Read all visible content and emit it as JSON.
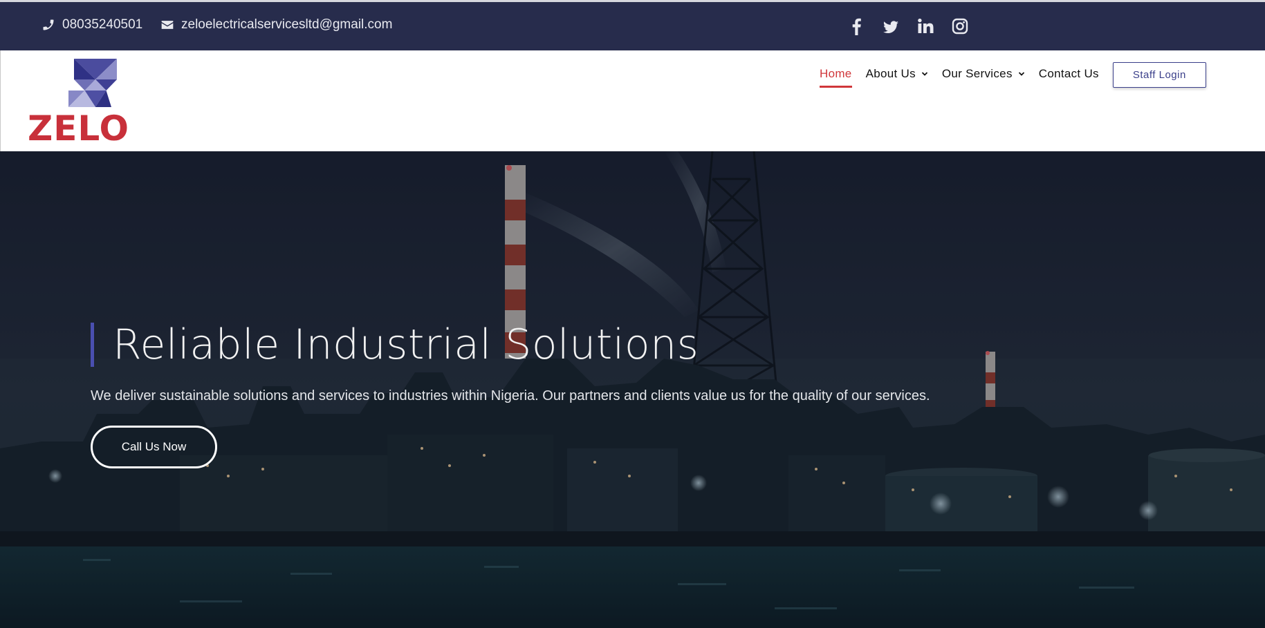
{
  "topbar": {
    "phone": "08035240501",
    "email": "zeloelectricalservicesltd@gmail.com",
    "phone_icon": "phone-icon",
    "email_icon": "envelope-icon",
    "social": [
      "facebook-icon",
      "twitter-icon",
      "linkedin-icon",
      "instagram-icon"
    ]
  },
  "brand": {
    "name": "ZELO"
  },
  "nav": {
    "items": [
      {
        "label": "Home",
        "active": true
      },
      {
        "label": "About Us",
        "dropdown": true
      },
      {
        "label": "Our Services",
        "dropdown": true
      },
      {
        "label": "Contact Us"
      }
    ],
    "staff_login": "Staff Login"
  },
  "hero": {
    "title": "Reliable Industrial Solutions",
    "subtitle": "We deliver sustainable solutions and services to industries within Nigeria. Our partners and clients value us for the quality of our services.",
    "cta": "Call Us Now"
  },
  "colors": {
    "topbar_bg": "#272c4c",
    "accent_red": "#d0363a",
    "accent_blue": "#3a3f8a"
  }
}
